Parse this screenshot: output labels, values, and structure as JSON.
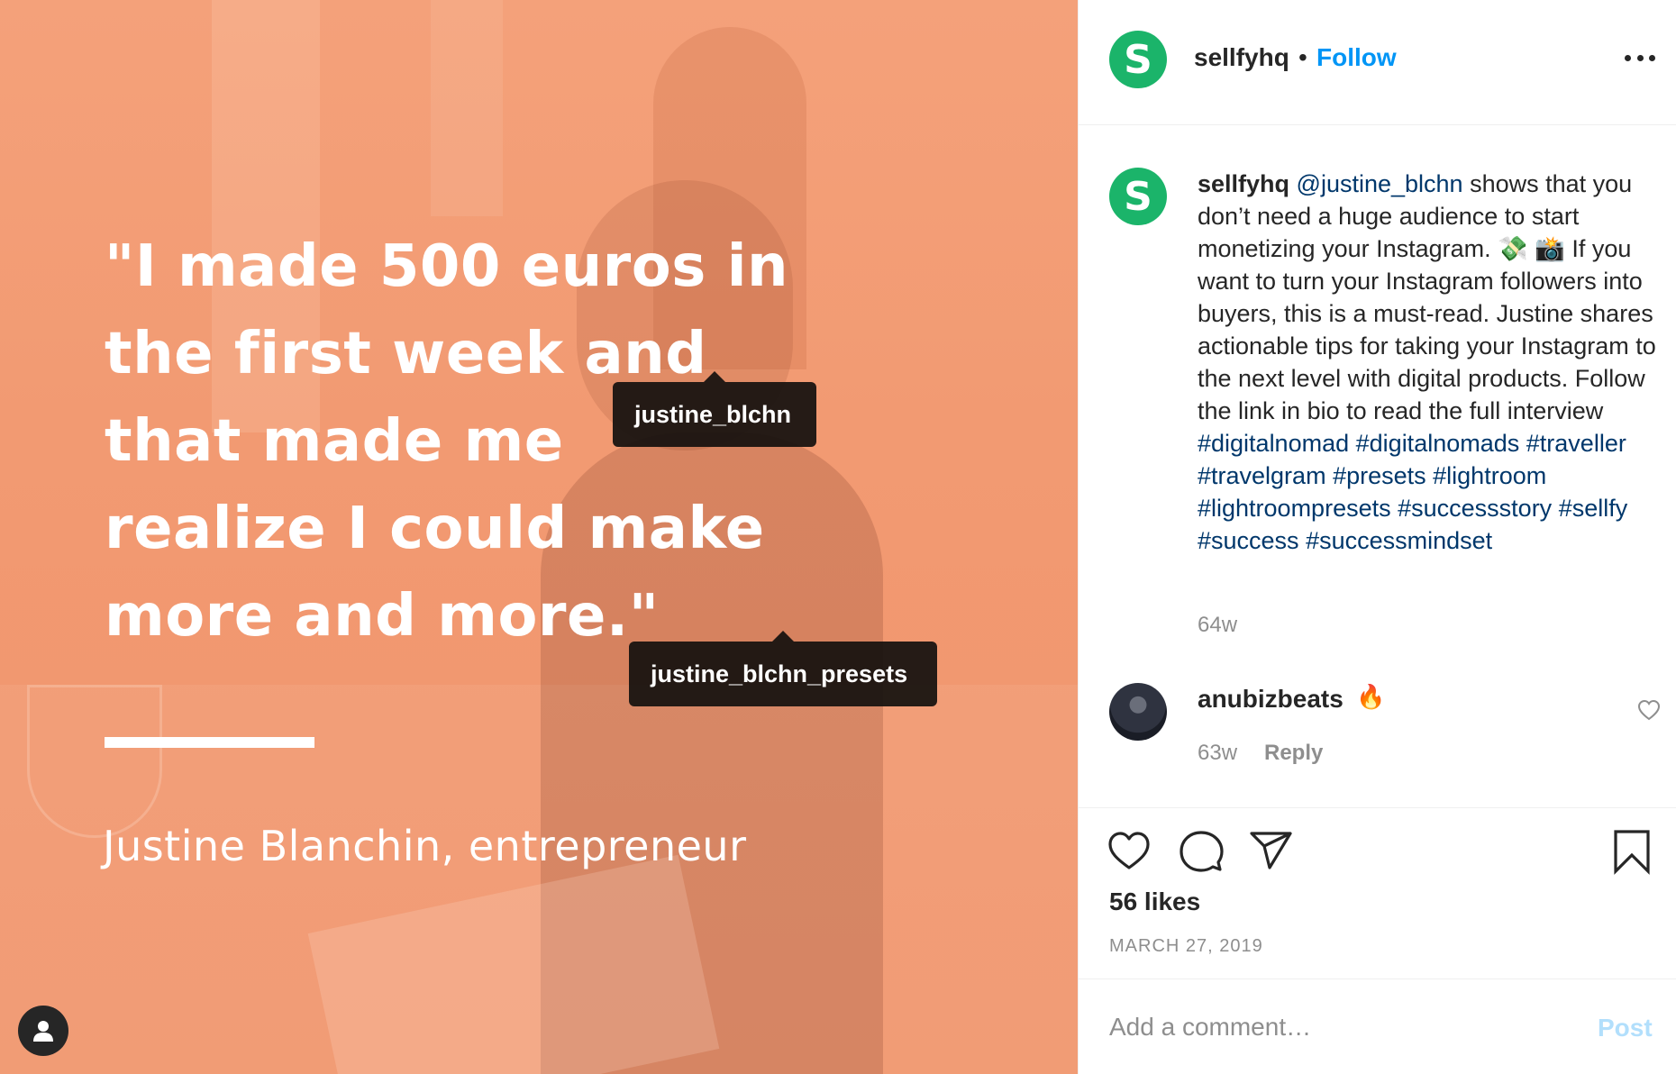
{
  "post_image": {
    "quote": "\"I made 500 euros in the first week and that made me realize I could make more and more.\"",
    "attribution": "Justine Blanchin, entrepreneur",
    "tags": [
      "justine_blchn",
      "justine_blchn_presets"
    ],
    "background_color": "#f29a72"
  },
  "header": {
    "avatar_letter": "S",
    "username": "sellfyhq",
    "separator": "•",
    "follow_label": "Follow",
    "more_icon": "more-horizontal-icon"
  },
  "caption": {
    "avatar_letter": "S",
    "username": "sellfyhq",
    "mention": "@justine_blchn",
    "text_1": " shows that you don’t need a huge audience to start monetizing your Instagram. 💸 📸 If you want to turn your Instagram followers into buyers, this is a must-read. Justine shares actionable tips for taking your Instagram to the next level with digital products. Follow the link in bio to read the full interview ",
    "hashtags": [
      "#digitalnomad",
      "#digitalnomads",
      "#traveller",
      "#travelgram",
      "#presets",
      "#lightroom",
      "#lightroompresets",
      "#successstory",
      "#sellfy",
      "#success",
      "#successmindset"
    ],
    "time": "64w"
  },
  "reply": {
    "username": "anubizbeats",
    "text": "🔥",
    "time": "63w",
    "reply_label": "Reply"
  },
  "actions": {
    "likes": "56 likes",
    "date": "MARCH 27, 2019"
  },
  "add_comment": {
    "placeholder": "Add a comment…",
    "post_label": "Post"
  },
  "colors": {
    "brand_green": "#1bb46a",
    "link_blue": "#0095f6",
    "hashtag_blue": "#00376b",
    "muted": "#8e8e8e"
  }
}
